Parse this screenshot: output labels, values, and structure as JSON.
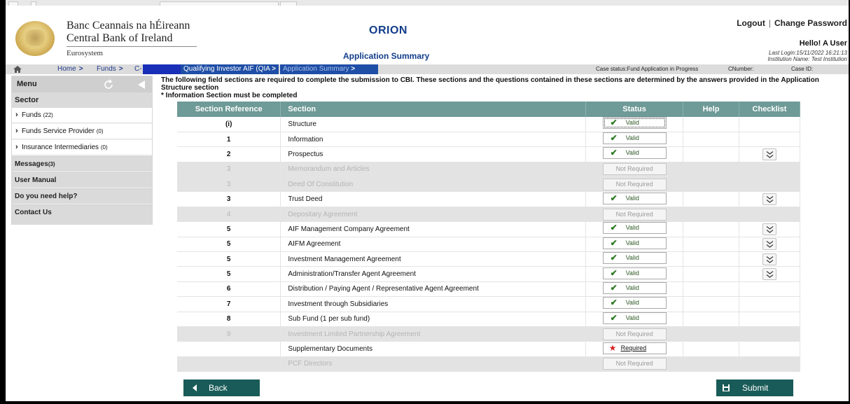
{
  "bank": {
    "name_irish": "Banc Ceannais na hÉireann",
    "name_english": "Central Bank of Ireland",
    "eurosystem": "Eurosystem"
  },
  "app": {
    "title": "ORION",
    "page_title": "Application Summary"
  },
  "user": {
    "logout": "Logout",
    "separator": "|",
    "change_password": "Change Password",
    "hello": "Hello! A User",
    "last_login": "Last Login:15/11/2022 16:21:13",
    "institution": "Institution Name: Test Institution"
  },
  "breadcrumb": {
    "home": "Home",
    "funds": "Funds",
    "c_prefix": "C-",
    "fund_type": "Qualifying Investor AIF (QIA",
    "current": "Application Summary",
    "arrow": ">"
  },
  "case": {
    "status": "Case status:Fund Application in Progress",
    "cnumber": "CNumber:",
    "case_id": "Case ID:"
  },
  "sidebar": {
    "menu": "Menu",
    "sector": "Sector",
    "items": [
      {
        "label": "Funds",
        "count": "(22)"
      },
      {
        "label": "Funds Service Provider",
        "count": "(0)"
      },
      {
        "label": "Insurance Intermediaries",
        "count": "(0)"
      }
    ],
    "messages": "Messages",
    "messages_count": "(3)",
    "user_manual": "User Manual",
    "need_help": "Do you need help?",
    "contact": "Contact Us"
  },
  "intro": {
    "line1": "The following field sections are required to complete the submission to CBI. These sections and the questions contained in these sections are determined by the answers provided in the Application Structure section",
    "line2": "* Information Section must be completed"
  },
  "table": {
    "headers": [
      "Section Reference",
      "Section",
      "Status",
      "Help",
      "Checklist"
    ],
    "rows": [
      {
        "ref": "(i)",
        "section": "Structure",
        "status": "Valid",
        "checklist": false,
        "required": true
      },
      {
        "ref": "1",
        "section": "Information",
        "status": "Valid",
        "checklist": false,
        "required": true
      },
      {
        "ref": "2",
        "section": "Prospectus",
        "status": "Valid",
        "checklist": true,
        "required": true
      },
      {
        "ref": "3",
        "section": "Memorandum and Articles",
        "status": "Not Required",
        "checklist": false,
        "required": false
      },
      {
        "ref": "3",
        "section": "Deed Of Constitution",
        "status": "Not Required",
        "checklist": false,
        "required": false
      },
      {
        "ref": "3",
        "section": "Trust Deed",
        "status": "Valid",
        "checklist": true,
        "required": true
      },
      {
        "ref": "4",
        "section": "Depositary Agreement",
        "status": "Not Required",
        "checklist": false,
        "required": false
      },
      {
        "ref": "5",
        "section": "AIF Management Company Agreement",
        "status": "Valid",
        "checklist": true,
        "required": true
      },
      {
        "ref": "5",
        "section": "AIFM Agreement",
        "status": "Valid",
        "checklist": true,
        "required": true
      },
      {
        "ref": "5",
        "section": "Investment Management Agreement",
        "status": "Valid",
        "checklist": true,
        "required": true
      },
      {
        "ref": "5",
        "section": "Administration/Transfer Agent Agreement",
        "status": "Valid",
        "checklist": true,
        "required": true
      },
      {
        "ref": "6",
        "section": "Distribution / Paying Agent / Representative Agent Agreement",
        "status": "Valid",
        "checklist": false,
        "required": true
      },
      {
        "ref": "7",
        "section": "Investment through Subsidiaries",
        "status": "Valid",
        "checklist": false,
        "required": true
      },
      {
        "ref": "8",
        "section": "Sub Fund (1 per sub fund)",
        "status": "Valid",
        "checklist": false,
        "required": true
      },
      {
        "ref": "9",
        "section": "Investment Limited Partnership Agreement",
        "status": "Not Required",
        "checklist": false,
        "required": false
      },
      {
        "ref": "",
        "section": "Supplementary Documents",
        "status": "Required",
        "checklist": false,
        "required": true
      },
      {
        "ref": "",
        "section": "PCF Directors",
        "status": "Not Required",
        "checklist": false,
        "required": false
      }
    ]
  },
  "buttons": {
    "back": "Back",
    "submit": "Submit"
  },
  "colors": {
    "header_teal": "#6e9a97",
    "button_teal": "#195b58",
    "brand_blue": "#123d8a",
    "valid_green": "#2e7a24",
    "required_red": "#d42020"
  }
}
